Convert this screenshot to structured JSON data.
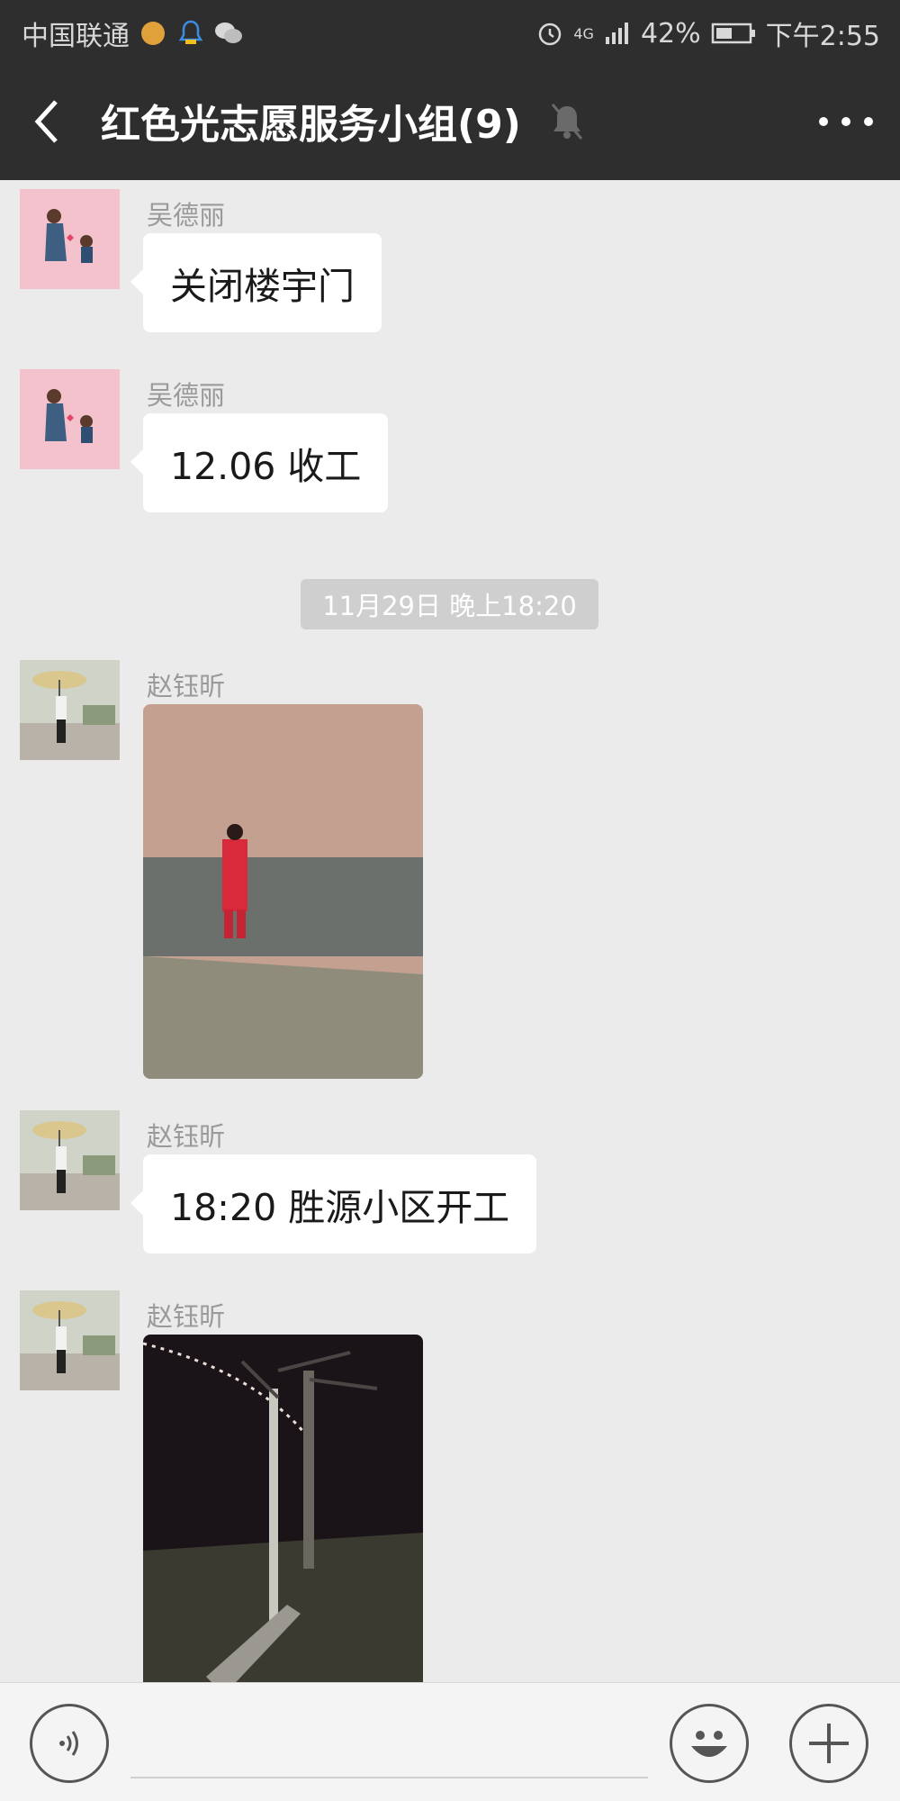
{
  "status_bar": {
    "carrier": "中国联通",
    "network": "4G",
    "battery": "42%",
    "time": "下午2:55"
  },
  "header": {
    "title": "红色光志愿服务小组(9)"
  },
  "messages": [
    {
      "sender": "吴德丽",
      "type": "text",
      "text": "关闭楼宇门"
    },
    {
      "sender": "吴德丽",
      "type": "text",
      "text": "12.06 收工"
    },
    {
      "type": "timestamp",
      "text": "11月29日 晚上18:20"
    },
    {
      "sender": "赵钰昕",
      "type": "image"
    },
    {
      "sender": "赵钰昕",
      "type": "text",
      "text": "18:20 胜源小区开工"
    },
    {
      "sender": "赵钰昕",
      "type": "image"
    }
  ],
  "input_bar": {
    "placeholder": ""
  },
  "colors": {
    "bar_bg": "#2e2e2e",
    "chat_bg": "#ebebeb",
    "bubble_bg": "#ffffff",
    "timestamp_bg": "#cfcfcf"
  },
  "icons": [
    "back-arrow-icon",
    "mute-bell-icon",
    "more-dots-icon",
    "voice-icon",
    "emoji-icon",
    "plus-icon",
    "alarm-icon",
    "signal-icon",
    "battery-icon"
  ]
}
